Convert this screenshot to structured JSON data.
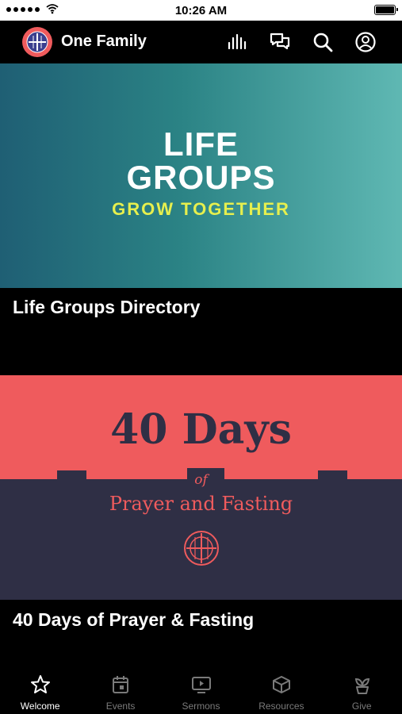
{
  "status_bar": {
    "time": "10:26 AM"
  },
  "header": {
    "title": "One Family",
    "icons": [
      "logo-icon",
      "live-audio-icon",
      "chat-icon",
      "search-icon",
      "profile-icon"
    ]
  },
  "cards": [
    {
      "banner_lines": [
        "LIFE",
        "GROUPS"
      ],
      "banner_subtitle": "GROW TOGETHER",
      "title": "Life Groups Directory"
    },
    {
      "banner_title": "40 Days",
      "banner_of": "of",
      "banner_subtitle": "Prayer and Fasting",
      "title": "40 Days of Prayer & Fasting"
    }
  ],
  "tabbar": {
    "tabs": [
      {
        "label": "Welcome",
        "icon": "star-icon",
        "active": true
      },
      {
        "label": "Events",
        "icon": "calendar-icon",
        "active": false
      },
      {
        "label": "Sermons",
        "icon": "video-icon",
        "active": false
      },
      {
        "label": "Resources",
        "icon": "box-icon",
        "active": false
      },
      {
        "label": "Give",
        "icon": "plant-icon",
        "active": false
      }
    ]
  },
  "colors": {
    "background": "#000000",
    "teal_banner": "#2b8385",
    "coral": "#ef5b5d",
    "navy": "#2f2f45",
    "accent_yellow": "#e6ef4e",
    "inactive_tab": "#7a7a7a"
  }
}
